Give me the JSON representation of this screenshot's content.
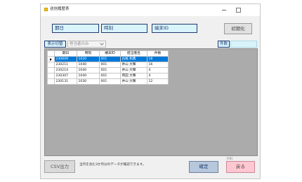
{
  "window": {
    "title": "送信履歴表"
  },
  "filters": {
    "date": "期日",
    "time": "時刻",
    "terminal_id": "端末ID",
    "reset_button": "初期化"
  },
  "display": {
    "toggle_label": "表示切替",
    "toggle_value": "担当者のみ",
    "count_label": "件数",
    "count_value": ""
  },
  "grid": {
    "columns": {
      "date": "期日",
      "time": "時刻",
      "terminal_id": "端末ID",
      "staff": "担当者名",
      "count": "件数"
    },
    "rows": [
      {
        "date": "230609",
        "time": "1020",
        "terminal_id": "001",
        "staff": "古尾 和典",
        "count": "18",
        "selected": true
      },
      {
        "date": "230211",
        "time": "1040",
        "terminal_id": "001",
        "staff": "井山 大輝",
        "count": "16",
        "selected": false
      },
      {
        "date": "230214",
        "time": "1040",
        "terminal_id": "001",
        "staff": "井山 大輝",
        "count": "4",
        "selected": false
      },
      {
        "date": "230307",
        "time": "1040",
        "terminal_id": "001",
        "staff": "岡田 大輝",
        "count": "4",
        "selected": false
      },
      {
        "date": "230131",
        "time": "1030",
        "terminal_id": "001",
        "staff": "井山 大輝",
        "count": "12",
        "selected": false
      }
    ]
  },
  "footer": {
    "csv_button": "CSV出力",
    "note": "当月を含む3か月分のデータが確認できます。",
    "confirm_button": "確定",
    "back_shortcut": "[F8]",
    "back_button": "戻る"
  },
  "icons": {
    "app": "app-icon",
    "minimize": "minimize-icon",
    "maximize": "maximize-icon",
    "dropdown": "chevron-down-icon",
    "current_row": "current-row-arrow-icon"
  },
  "colors": {
    "selection": "#0078d7",
    "field_fill": "#d9f4fb",
    "field_border": "#1f3a70",
    "grid_background": "#ababab",
    "confirm_button": "#b7c7dc",
    "back_button": "#ffc7d1",
    "title_icon": "#f2c41a"
  }
}
